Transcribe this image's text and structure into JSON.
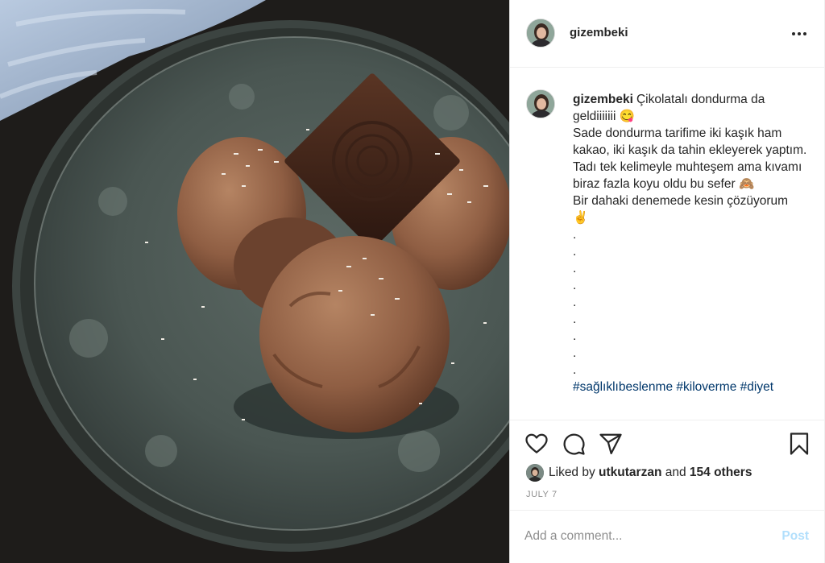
{
  "post": {
    "username": "gizembeki",
    "more_icon": "more-horizontal-icon",
    "caption": {
      "username": "gizembeki",
      "line1": "Çikolatalı dondurma da geldiiiiiii",
      "emoji1": "😋",
      "line2": "Sade dondurma tarifime iki kaşık ham kakao, iki kaşık da tahin ekleyerek yaptım. Tadı tek kelimeyle muhteşem ama kıvamı biraz fazla koyu oldu bu sefer",
      "emoji2": "🙈",
      "line3": "Bir dahaki denemede kesin çözüyorum",
      "emoji3": "✌️",
      "dots": [
        ".",
        ".",
        ".",
        ".",
        ".",
        ".",
        ".",
        ".",
        "."
      ],
      "hashtags": [
        "#sağlıklıbeslenme",
        "#kiloverme",
        "#diyet"
      ]
    },
    "actions": {
      "like_icon": "heart-icon",
      "comment_icon": "comment-icon",
      "share_icon": "share-icon",
      "save_icon": "bookmark-icon"
    },
    "likes": {
      "prefix": "Liked by",
      "liker": "utkutarzan",
      "conj": "and",
      "others": "154 others"
    },
    "date": "JULY 7",
    "comment": {
      "placeholder": "Add a comment...",
      "post_label": "Post"
    }
  },
  "colors": {
    "hashtag": "#00376b",
    "post_button_disabled": "#b2dffc",
    "meta_gray": "#8e8e8e"
  }
}
